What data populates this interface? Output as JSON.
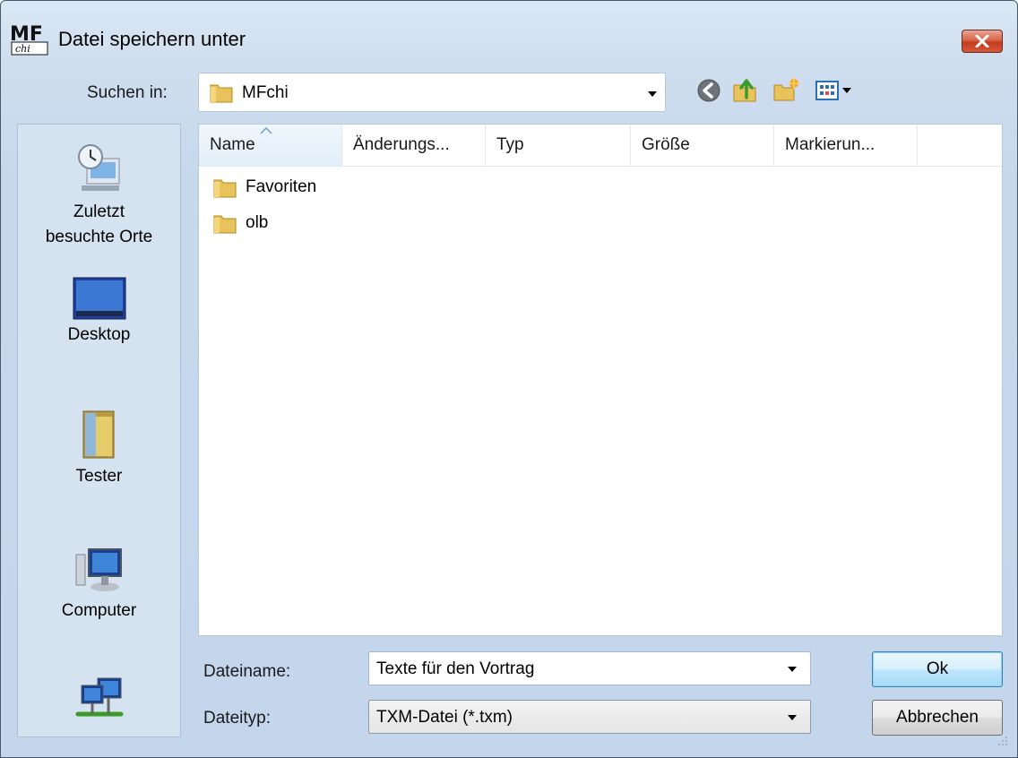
{
  "window": {
    "title": "Datei speichern unter",
    "app_icon": "mfchi-logo-icon"
  },
  "toolbar": {
    "lookin_label": "Suchen in:",
    "lookin_value": "MFchi",
    "buttons": [
      "back-icon",
      "up-folder-icon",
      "new-folder-icon",
      "views-menu-icon"
    ]
  },
  "places": [
    {
      "label": "Zuletzt\nbesuchte Orte",
      "icon": "recent-places-icon"
    },
    {
      "label": "Desktop",
      "icon": "desktop-icon"
    },
    {
      "label": "Tester",
      "icon": "user-folder-icon"
    },
    {
      "label": "Computer",
      "icon": "computer-icon"
    },
    {
      "label": "",
      "icon": "network-icon"
    }
  ],
  "filelist": {
    "columns": [
      "Name",
      "Änderungs...",
      "Typ",
      "Größe",
      "Markierun..."
    ],
    "sorted_column": "Name",
    "items": [
      {
        "name": "Favoriten",
        "icon": "folder-icon"
      },
      {
        "name": "olb",
        "icon": "folder-icon"
      }
    ]
  },
  "form": {
    "filename_label": "Dateiname:",
    "filename_value": "Texte für den Vortrag",
    "filetype_label": "Dateityp:",
    "filetype_value": "TXM-Datei (*.txm)"
  },
  "buttons": {
    "ok": "Ok",
    "cancel": "Abbrechen"
  },
  "colors": {
    "accent": "#3c7fb1",
    "close": "#c23c20",
    "chrome": "#cfdeef"
  }
}
